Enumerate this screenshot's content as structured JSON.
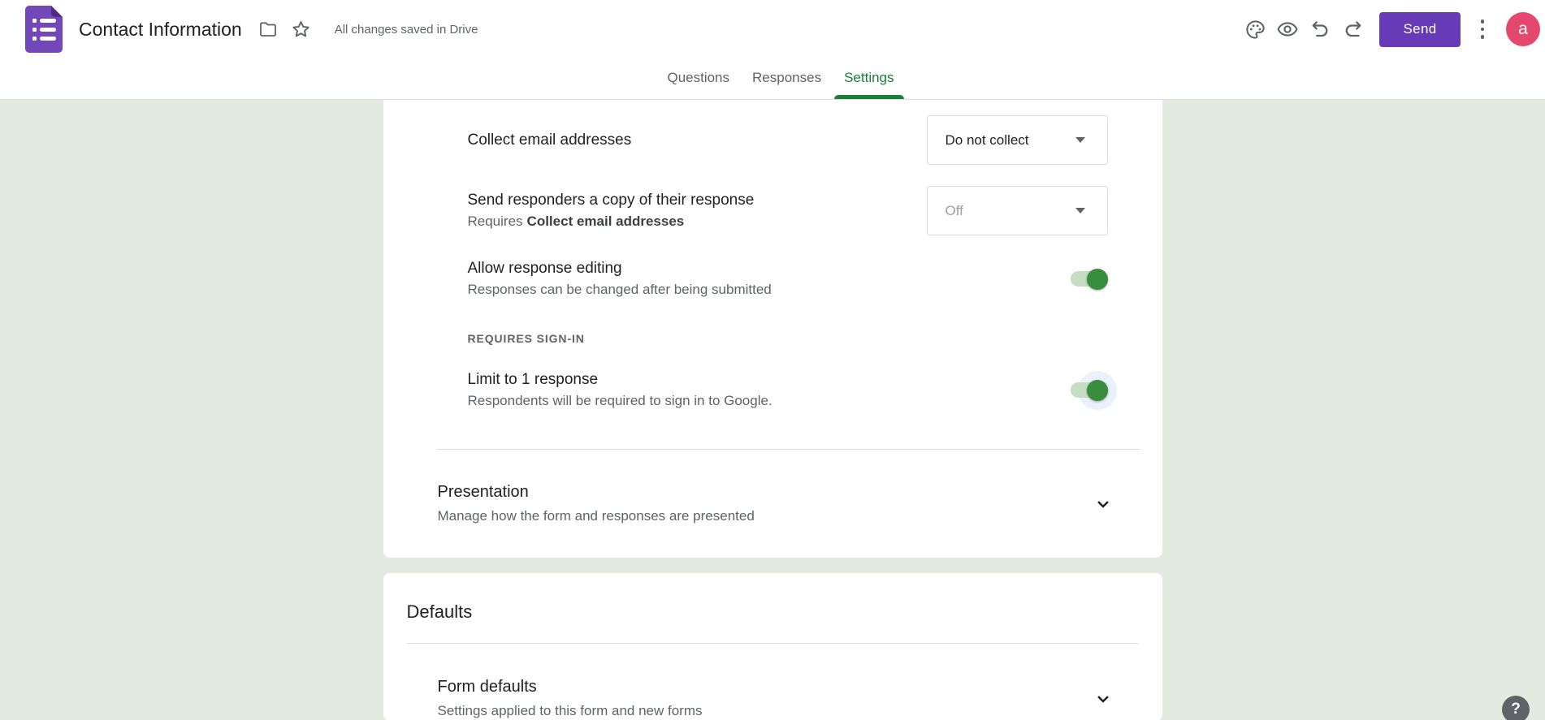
{
  "header": {
    "title": "Contact Information",
    "status_text": "All changes saved in Drive",
    "send_label": "Send",
    "avatar_letter": "a"
  },
  "tabs": {
    "questions": "Questions",
    "responses": "Responses",
    "settings": "Settings",
    "active_tab": "Settings"
  },
  "settings_panel": {
    "collect_email": {
      "title": "Collect email addresses",
      "value": "Do not collect"
    },
    "send_copy": {
      "title": "Send responders a copy of their response",
      "requires_prefix": "Requires",
      "requires_bold": "Collect email addresses",
      "value": "Off",
      "state": "disabled"
    },
    "allow_editing": {
      "title": "Allow response editing",
      "subtitle": "Responses can be changed after being submitted",
      "state": "on"
    },
    "section_label": "REQUIRES SIGN-IN",
    "limit_response": {
      "title": "Limit to 1 response",
      "subtitle": "Respondents will be required to sign in to Google.",
      "state": "on"
    },
    "presentation": {
      "title": "Presentation",
      "subtitle": "Manage how the form and responses are presented"
    }
  },
  "defaults_panel": {
    "heading": "Defaults",
    "form_defaults": {
      "title": "Form defaults",
      "subtitle": "Settings applied to this form and new forms"
    }
  },
  "help": {
    "label": "?"
  },
  "colors": {
    "accent_purple": "#673ab7",
    "logo_purple": "#7248b9",
    "tab_active_green": "#188038",
    "toggle_on_green": "#388e3c",
    "page_background": "#e3ebe1",
    "avatar_pink": "#e5486e",
    "divider_gray": "#dadce0"
  }
}
